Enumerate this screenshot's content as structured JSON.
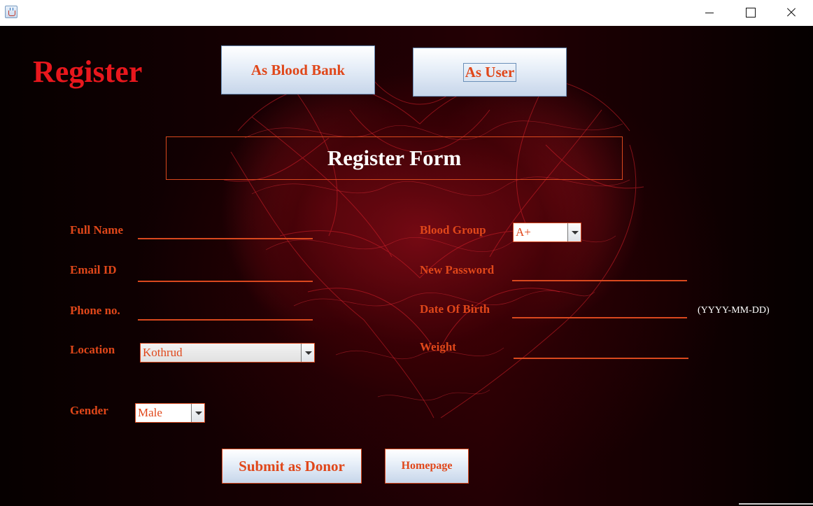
{
  "window": {
    "icon": "java-cup-icon",
    "controls": [
      "minimize-icon",
      "maximize-icon",
      "close-icon"
    ]
  },
  "header": {
    "title": "Register",
    "tabs": {
      "blood_bank": "As Blood Bank",
      "user": "As User"
    }
  },
  "form": {
    "heading": "Register Form",
    "full_name": {
      "label": "Full Name",
      "value": ""
    },
    "email": {
      "label": "Email ID",
      "value": ""
    },
    "phone": {
      "label": "Phone no.",
      "value": ""
    },
    "location": {
      "label": "Location",
      "value": "Kothrud"
    },
    "gender": {
      "label": "Gender",
      "value": "Male"
    },
    "blood_group": {
      "label": "Blood Group",
      "value": "A+"
    },
    "password": {
      "label": "New Password",
      "value": ""
    },
    "dob": {
      "label": "Date Of Birth",
      "value": "",
      "hint": "(YYYY-MM-DD)"
    },
    "weight": {
      "label": "Weight",
      "value": ""
    }
  },
  "actions": {
    "submit": "Submit as Donor",
    "homepage": "Homepage"
  },
  "colors": {
    "accent": "#e0471a",
    "title_red": "#e8171d",
    "background": "#1a0003"
  }
}
